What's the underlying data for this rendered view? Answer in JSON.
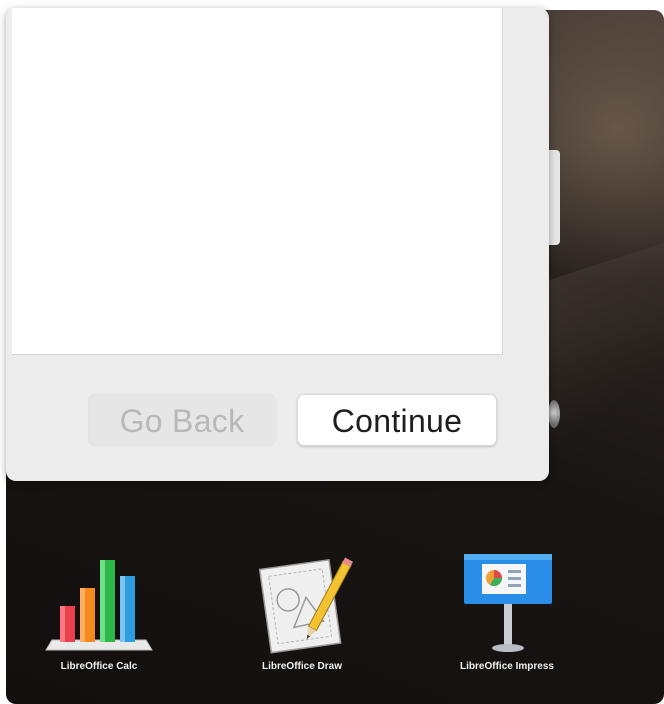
{
  "dialog": {
    "back_label": "Go Back",
    "continue_label": "Continue"
  },
  "dock": {
    "items": [
      {
        "label": "LibreOffice Calc",
        "icon": "libreoffice-calc-icon"
      },
      {
        "label": "LibreOffice Draw",
        "icon": "libreoffice-draw-icon"
      },
      {
        "label": "LibreOffice Impress",
        "icon": "libreoffice-impress-icon"
      }
    ]
  },
  "colors": {
    "dialog_bg": "#ececec",
    "button_disabled_text": "#b8b8b8",
    "button_text": "#1e1e1e",
    "calc_bar_red": "#e8404d",
    "calc_bar_orange": "#f5891e",
    "calc_bar_green": "#2db84a",
    "calc_bar_blue": "#2e9de0",
    "impress_blue": "#2a8ee8"
  }
}
